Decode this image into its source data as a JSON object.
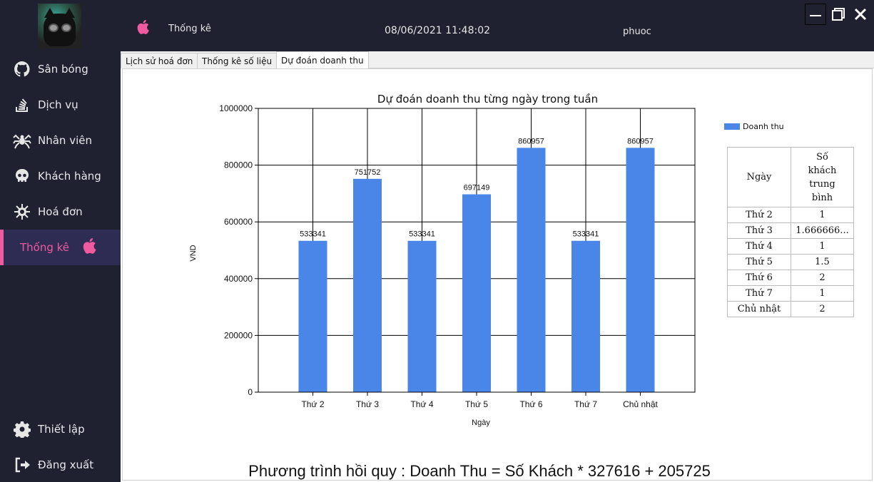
{
  "sidebar": {
    "items": [
      {
        "label": "Sân bóng",
        "icon": "github-icon"
      },
      {
        "label": "Dịch vụ",
        "icon": "stackoverflow-icon"
      },
      {
        "label": "Nhân viên",
        "icon": "spider-icon"
      },
      {
        "label": "Khách hàng",
        "icon": "skull-icon"
      },
      {
        "label": "Hoá đơn",
        "icon": "virus-icon"
      },
      {
        "label": "Thống kê",
        "icon": "apple-icon",
        "active": true
      }
    ],
    "bottom": [
      {
        "label": "Thiết lập",
        "icon": "gear-icon"
      },
      {
        "label": "Đăng xuất",
        "icon": "logout-icon"
      }
    ]
  },
  "header": {
    "title": "Thống kê",
    "datetime": "08/06/2021 11:48:02",
    "user": "phuoc"
  },
  "tabs": [
    "Lịch sử hoá đơn",
    "Thống kê số liệu",
    "Dự đoán doanh thu"
  ],
  "active_tab": 2,
  "chart_data": {
    "type": "bar",
    "title": "Dự đoán doanh thu từng ngày trong tuần",
    "xlabel": "Ngày",
    "ylabel": "VND",
    "categories": [
      "Thứ 2",
      "Thứ 3",
      "Thứ 4",
      "Thứ 5",
      "Thứ 6",
      "Thứ 7",
      "Chủ nhật"
    ],
    "series": [
      {
        "name": "Doanh thu",
        "values": [
          533341,
          751752,
          533341,
          697149,
          860957,
          533341,
          860957
        ],
        "color": "#4a86e8"
      }
    ],
    "ylim": [
      0,
      1000000
    ],
    "yticks": [
      "0",
      "200000",
      "400000",
      "600000",
      "800000",
      "1000000"
    ],
    "grid": true,
    "legend": "top-right"
  },
  "table": {
    "headers": [
      "Ngày",
      "Số khách trung bình"
    ],
    "rows": [
      [
        "Thứ 2",
        "1"
      ],
      [
        "Thứ 3",
        "1.666666..."
      ],
      [
        "Thứ 4",
        "1"
      ],
      [
        "Thứ 5",
        "1.5"
      ],
      [
        "Thứ 6",
        "2"
      ],
      [
        "Thứ 7",
        "1"
      ],
      [
        "Chủ nhật",
        "2"
      ]
    ]
  },
  "regression": "Phương trình hồi quy : Doanh Thu = Số Khách * 327616 + 205725"
}
